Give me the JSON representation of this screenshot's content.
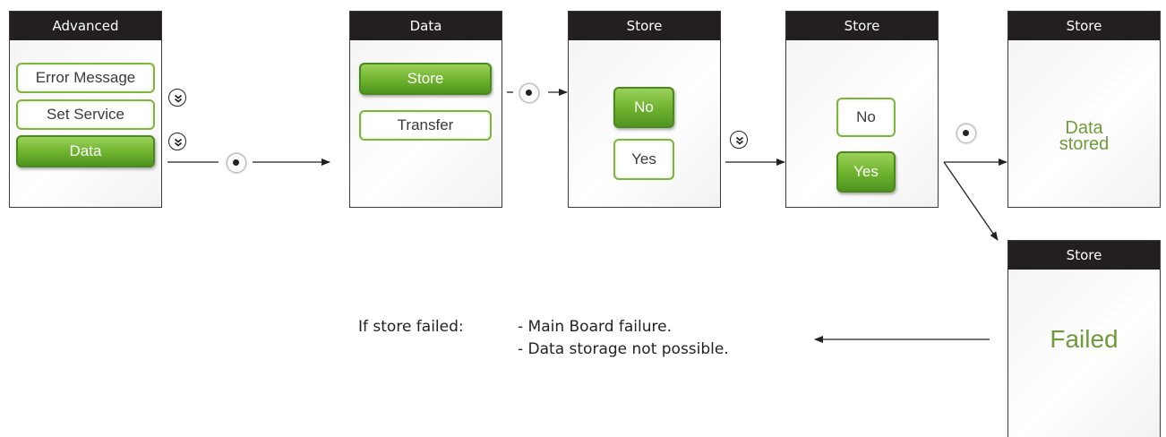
{
  "screens": {
    "advanced": {
      "title": "Advanced",
      "buttons": [
        "Error Message",
        "Set Service",
        "Data"
      ]
    },
    "data": {
      "title": "Data",
      "buttons": [
        "Store",
        "Transfer"
      ]
    },
    "store_no": {
      "title": "Store",
      "buttons": [
        "No",
        "Yes"
      ]
    },
    "store_yes": {
      "title": "Store",
      "buttons": [
        "No",
        "Yes"
      ]
    },
    "stored": {
      "title": "Store",
      "line1": "Data",
      "line2": "stored"
    },
    "failed": {
      "title": "Store",
      "message": "Failed"
    }
  },
  "icons": {
    "scroll": "double-chevron-down-icon",
    "select": "select-dot-icon"
  },
  "note": {
    "label": "If store failed:",
    "reasons": [
      "- Main Board failure.",
      "- Data storage not possible."
    ]
  },
  "colors": {
    "header": "#231f20",
    "green": "#6db22d",
    "green_text": "#6e9c3a"
  }
}
